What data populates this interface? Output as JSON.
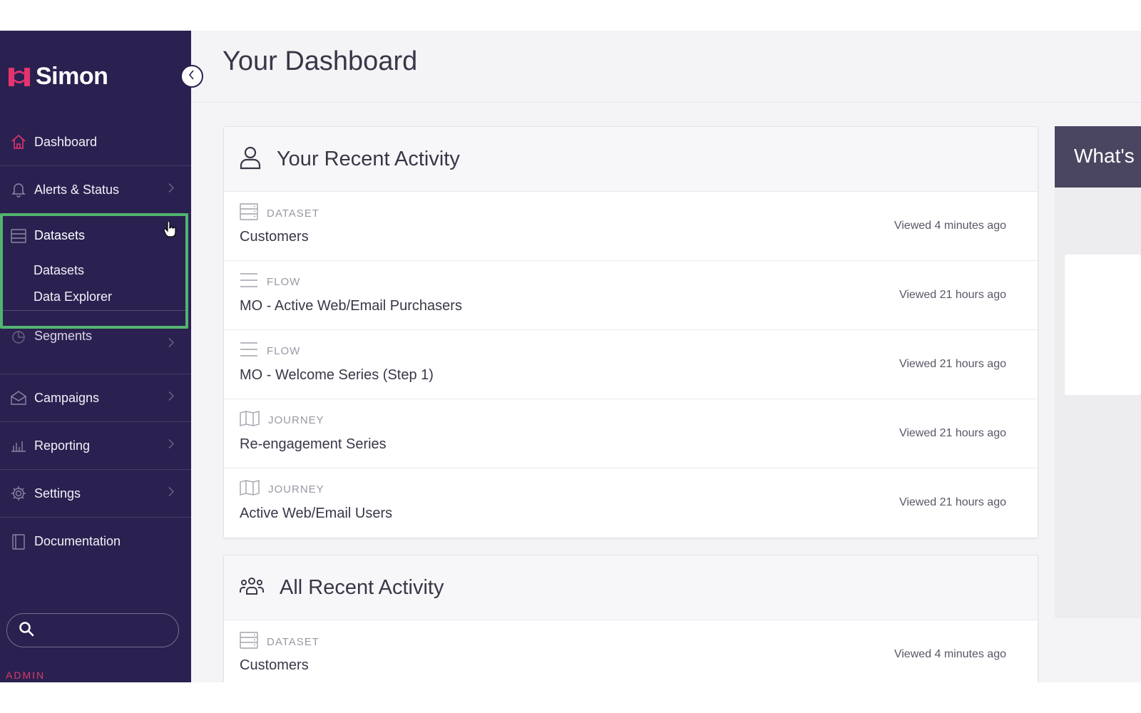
{
  "app": {
    "name": "Simon",
    "brand_color": "#e5336f",
    "sidebar_bg": "#2a2150",
    "highlight_color": "#52b56f"
  },
  "sidebar": {
    "items": [
      {
        "label": "Dashboard",
        "icon": "home-icon"
      },
      {
        "label": "Alerts & Status",
        "icon": "bell-icon"
      },
      {
        "label": "Datasets",
        "icon": "database-icon"
      },
      {
        "label": "Segments",
        "icon": "pie-icon"
      },
      {
        "label": "Campaigns",
        "icon": "envelope-icon"
      },
      {
        "label": "Reporting",
        "icon": "bar-chart-icon"
      },
      {
        "label": "Settings",
        "icon": "gear-icon"
      },
      {
        "label": "Documentation",
        "icon": "book-icon"
      }
    ],
    "datasets_submenu": [
      "Datasets",
      "Data Explorer"
    ],
    "search_placeholder": "",
    "role_label": "ADMIN"
  },
  "main": {
    "title": "Your Dashboard",
    "recent": {
      "title": "Your Recent Activity",
      "rows": [
        {
          "type": "DATASET",
          "name": "Customers",
          "viewed": "Viewed 4 minutes ago"
        },
        {
          "type": "FLOW",
          "name": "MO - Active Web/Email Purchasers",
          "viewed": "Viewed 21 hours ago"
        },
        {
          "type": "FLOW",
          "name": "MO - Welcome Series (Step 1)",
          "viewed": "Viewed 21 hours ago"
        },
        {
          "type": "JOURNEY",
          "name": "Re-engagement Series",
          "viewed": "Viewed 21 hours ago"
        },
        {
          "type": "JOURNEY",
          "name": "Active Web/Email Users",
          "viewed": "Viewed 21 hours ago"
        }
      ]
    },
    "all_recent": {
      "title": "All Recent Activity",
      "rows": [
        {
          "type": "DATASET",
          "name": "Customers",
          "viewed": "Viewed 4 minutes ago"
        }
      ]
    },
    "whats_new": {
      "title": "What's"
    }
  }
}
